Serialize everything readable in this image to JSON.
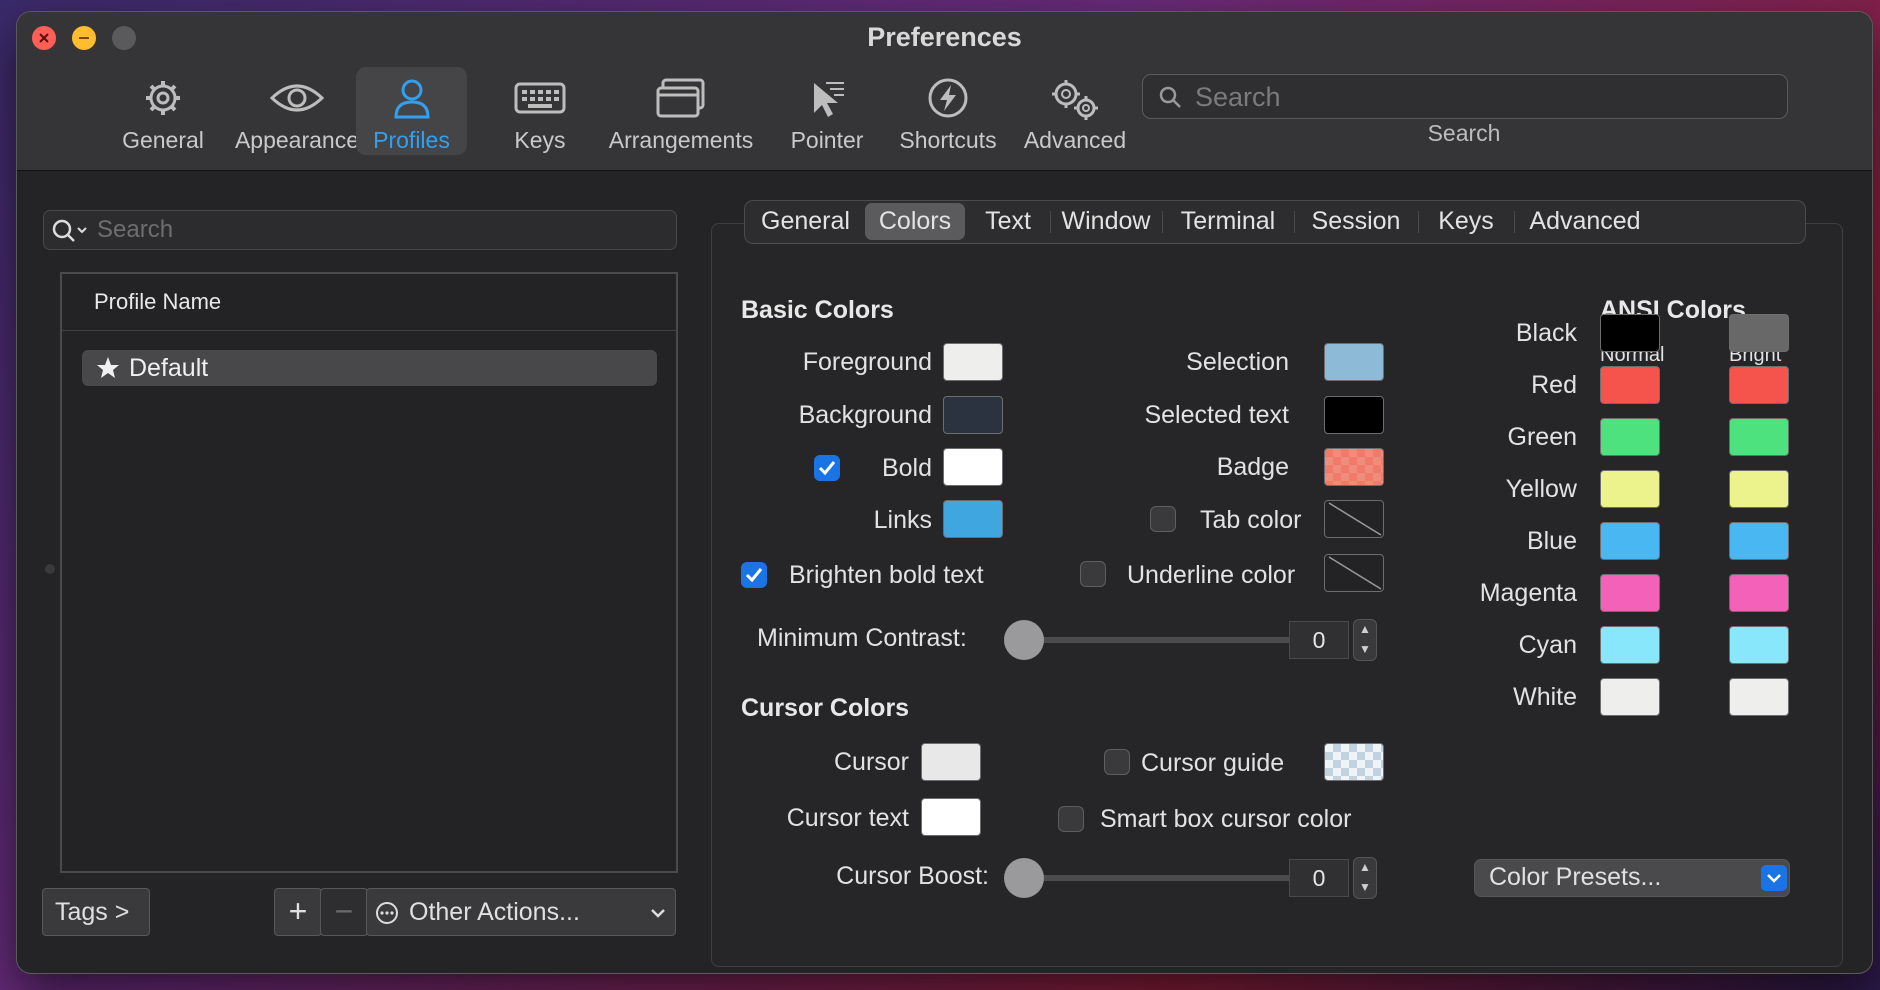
{
  "window": {
    "title": "Preferences"
  },
  "toolbar": {
    "items": [
      {
        "label": "General"
      },
      {
        "label": "Appearance"
      },
      {
        "label": "Profiles"
      },
      {
        "label": "Keys"
      },
      {
        "label": "Arrangements"
      },
      {
        "label": "Pointer"
      },
      {
        "label": "Shortcuts"
      },
      {
        "label": "Advanced"
      }
    ],
    "selected": "Profiles",
    "search_placeholder": "Search",
    "search_label": "Search"
  },
  "profiles": {
    "search_placeholder": "Search",
    "header": "Profile Name",
    "items": [
      {
        "name": "Default",
        "default": true
      }
    ],
    "tags_button": "Tags >",
    "add": "+",
    "remove": "−",
    "other_actions": "Other Actions..."
  },
  "tabs": {
    "items": [
      "General",
      "Colors",
      "Text",
      "Window",
      "Terminal",
      "Session",
      "Keys",
      "Advanced"
    ],
    "selected": "Colors"
  },
  "basic": {
    "title": "Basic Colors",
    "foreground": "Foreground",
    "background": "Background",
    "bold": "Bold",
    "links": "Links",
    "brighten": "Brighten bold text",
    "selection": "Selection",
    "selected_text": "Selected text",
    "badge": "Badge",
    "tab_color": "Tab color",
    "underline_color": "Underline color",
    "min_contrast": "Minimum Contrast:",
    "min_contrast_value": "0",
    "colors": {
      "foreground": "#eeeeec",
      "background": "#2b3340",
      "bold": "#ffffff",
      "links": "#3fa6df",
      "selection": "#8dbad7",
      "selected_text": "#000000",
      "badge": "#ef7c6a"
    }
  },
  "cursor": {
    "title": "Cursor Colors",
    "cursor": "Cursor",
    "cursor_text": "Cursor text",
    "cursor_guide": "Cursor guide",
    "smart_box": "Smart box cursor color",
    "boost": "Cursor Boost:",
    "boost_value": "0",
    "colors": {
      "cursor": "#e8e8e8",
      "cursor_text": "#ffffff",
      "cursor_guide": "#d8e4ee"
    }
  },
  "ansi": {
    "title": "ANSI Colors",
    "normal": "Normal",
    "bright": "Bright",
    "rows": [
      {
        "name": "Black",
        "normal": "#000000",
        "bright": "#686868"
      },
      {
        "name": "Red",
        "normal": "#f5544c",
        "bright": "#f5544c"
      },
      {
        "name": "Green",
        "normal": "#4ee27f",
        "bright": "#4ee27f"
      },
      {
        "name": "Yellow",
        "normal": "#ecf28c",
        "bright": "#ecf28c"
      },
      {
        "name": "Blue",
        "normal": "#48b7f2",
        "bright": "#48b7f2"
      },
      {
        "name": "Magenta",
        "normal": "#f361b8",
        "bright": "#f361b8"
      },
      {
        "name": "Cyan",
        "normal": "#88e7fa",
        "bright": "#88e7fa"
      },
      {
        "name": "White",
        "normal": "#eeeeec",
        "bright": "#eeeeec"
      }
    ],
    "presets": "Color Presets..."
  }
}
